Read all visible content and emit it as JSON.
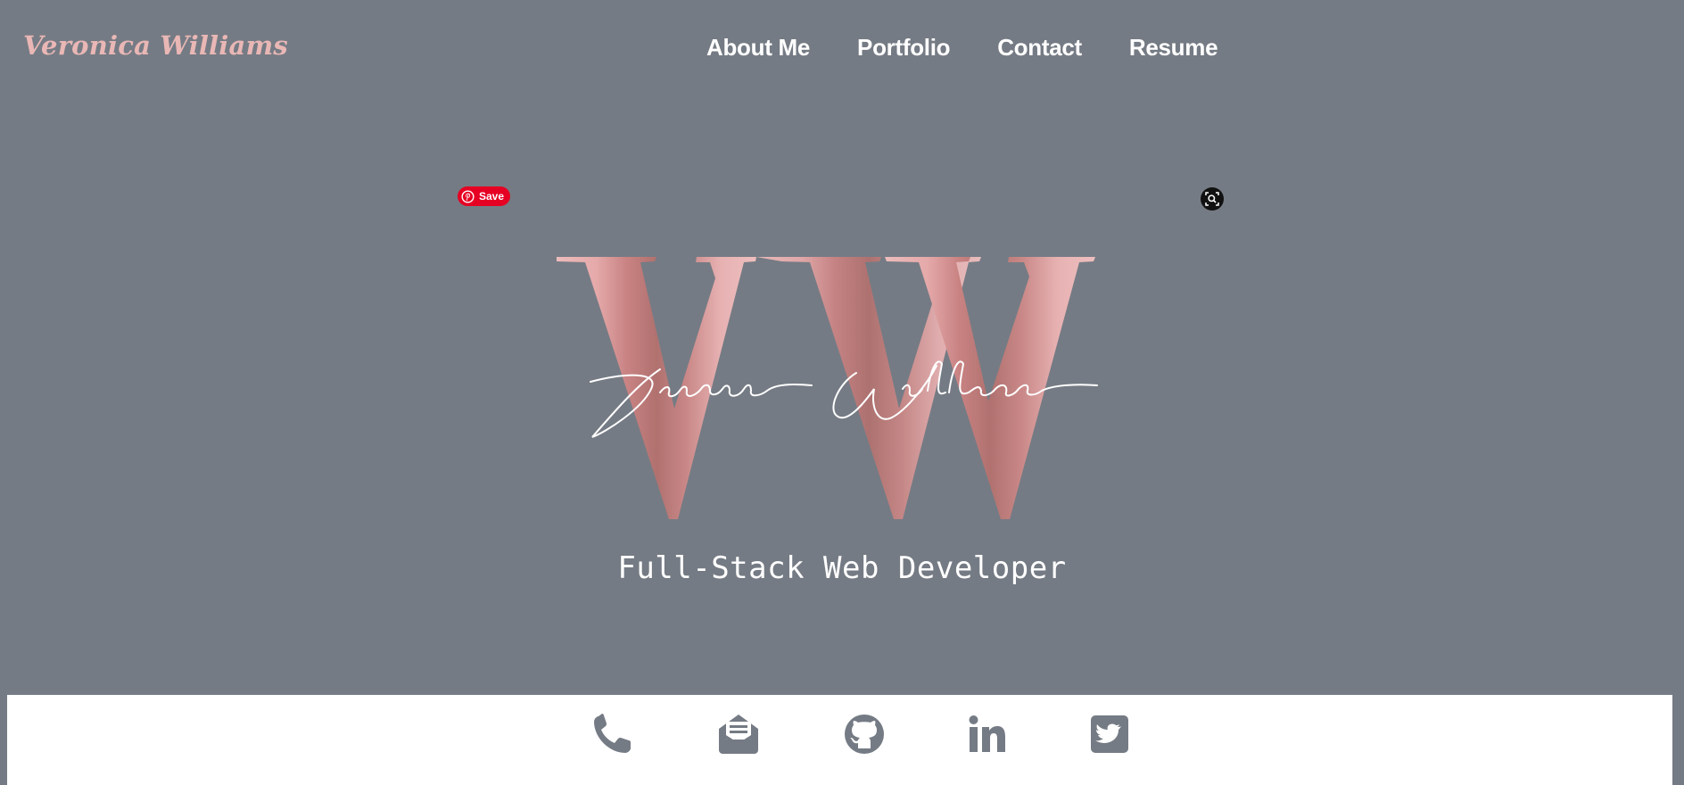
{
  "header": {
    "brand": "Veronica Williams",
    "nav": [
      {
        "label": "About Me"
      },
      {
        "label": "Portfolio"
      },
      {
        "label": "Contact"
      },
      {
        "label": "Resume"
      }
    ]
  },
  "hero": {
    "pinterest_save_label": "Save",
    "logo": {
      "monogram": "VW",
      "signature": "Veronica Williams"
    },
    "tagline": "Full-Stack Web Developer"
  },
  "social": {
    "icons": [
      "phone-icon",
      "email-icon",
      "github-icon",
      "linkedin-icon",
      "twitter-icon"
    ]
  },
  "colors": {
    "background": "#757b84",
    "accent_pink": "#e9b7b5",
    "icon_gray": "#757b84",
    "pinterest_red": "#e60023"
  }
}
